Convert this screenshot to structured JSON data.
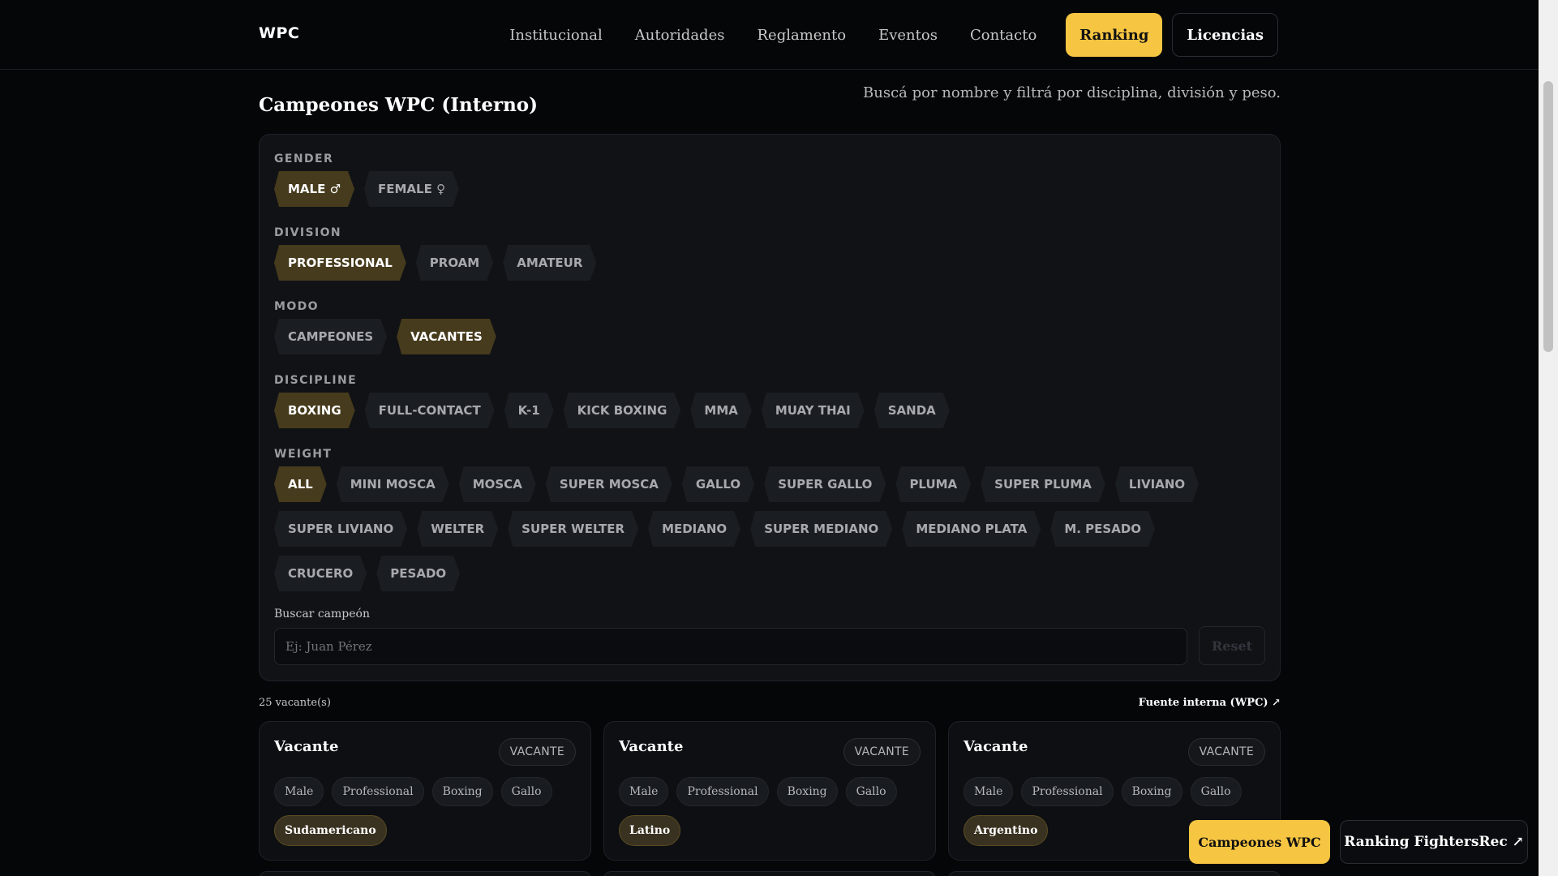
{
  "nav": {
    "brand": "WPC",
    "links": [
      "Institucional",
      "Autoridades",
      "Reglamento",
      "Eventos",
      "Contacto"
    ],
    "ranking": "Ranking",
    "licencias": "Licencias"
  },
  "header": {
    "title": "Campeones WPC (Interno)",
    "subtitle": "Buscá por nombre y filtrá por disciplina, división y peso."
  },
  "filters": {
    "gender": {
      "label": "GENDER",
      "options": [
        "MALE ♂",
        "FEMALE ♀"
      ],
      "active": 0
    },
    "division": {
      "label": "DIVISION",
      "options": [
        "PROFESSIONAL",
        "PROAM",
        "AMATEUR"
      ],
      "active": 0
    },
    "modo": {
      "label": "MODO",
      "options": [
        "CAMPEONES",
        "VACANTES"
      ],
      "active": 1
    },
    "discipline": {
      "label": "DISCIPLINE",
      "options": [
        "BOXING",
        "FULL-CONTACT",
        "K-1",
        "KICK BOXING",
        "MMA",
        "MUAY THAI",
        "SANDA"
      ],
      "active": 0
    },
    "weight": {
      "label": "WEIGHT",
      "options": [
        "ALL",
        "MINI MOSCA",
        "MOSCA",
        "SUPER MOSCA",
        "GALLO",
        "SUPER GALLO",
        "PLUMA",
        "SUPER PLUMA",
        "LIVIANO",
        "SUPER LIVIANO",
        "WELTER",
        "SUPER WELTER",
        "MEDIANO",
        "SUPER MEDIANO",
        "MEDIANO PLATA",
        "M. PESADO",
        "CRUCERO",
        "PESADO"
      ],
      "active": 0
    },
    "search": {
      "label": "Buscar campeón",
      "placeholder": "Ej: Juan Pérez",
      "value": ""
    },
    "reset": "Reset"
  },
  "results": {
    "count": "25 vacante(s)",
    "source": "Fuente interna (WPC) ↗",
    "cards": [
      {
        "title": "Vacante",
        "badge": "VACANTE",
        "tags": [
          "Male",
          "Professional",
          "Boxing",
          "Gallo"
        ],
        "region": "Sudamericano"
      },
      {
        "title": "Vacante",
        "badge": "VACANTE",
        "tags": [
          "Male",
          "Professional",
          "Boxing",
          "Gallo"
        ],
        "region": "Latino"
      },
      {
        "title": "Vacante",
        "badge": "VACANTE",
        "tags": [
          "Male",
          "Professional",
          "Boxing",
          "Gallo"
        ],
        "region": "Argentino"
      }
    ]
  },
  "floating": {
    "champions": "Campeones WPC",
    "ranking": "Ranking FightersRec ↗"
  },
  "colors": {
    "accent": "#f6c541",
    "chip_active": "#463b1c",
    "background": "#050608",
    "panel": "#101216"
  }
}
